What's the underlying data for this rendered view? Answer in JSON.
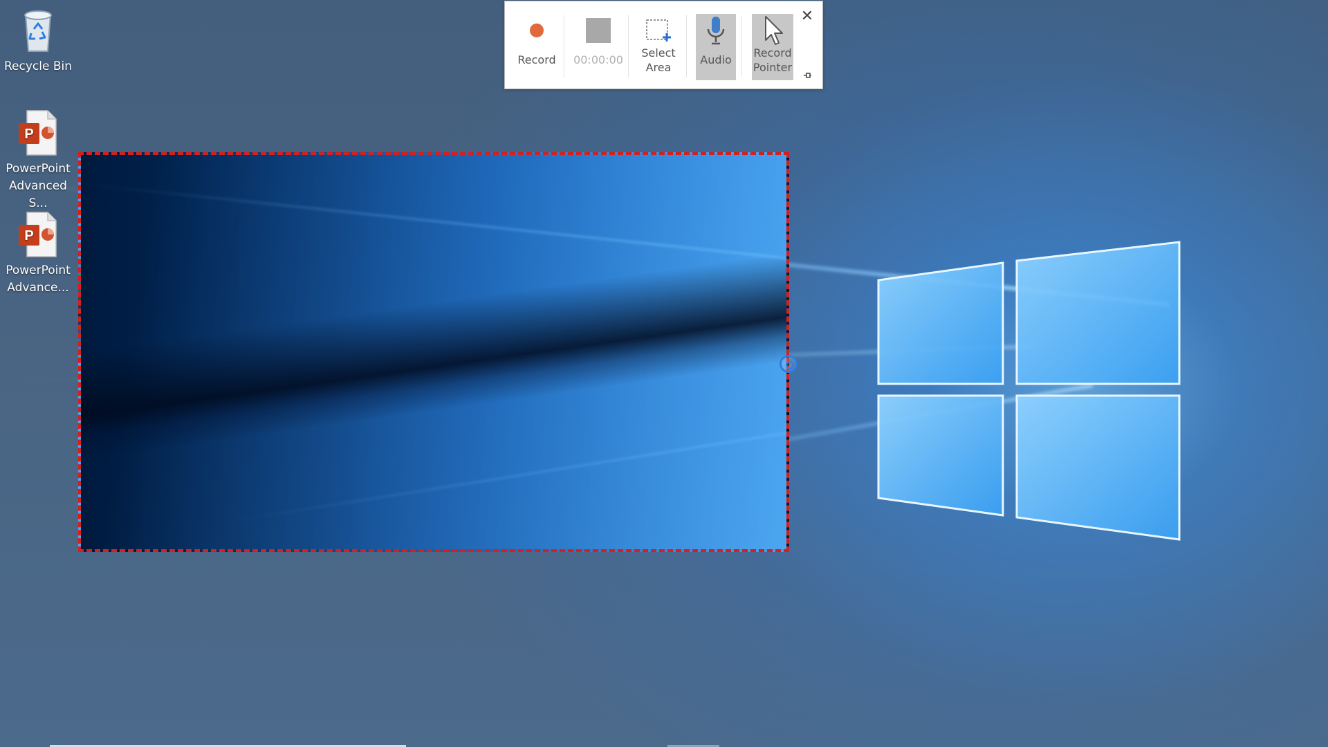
{
  "desktop": {
    "icons": [
      {
        "label": "Recycle Bin",
        "icon": "recycle-bin-icon"
      },
      {
        "label": "PowerPoint Advanced S...",
        "icon": "powerpoint-file-icon"
      },
      {
        "label": "PowerPoint Advance...",
        "icon": "powerpoint-file-icon"
      }
    ]
  },
  "toolbar": {
    "record_label": "Record",
    "timer_label": "00:00:00",
    "select_area_label": "Select Area",
    "audio_label": "Audio",
    "record_pointer_label": "Record Pointer",
    "close_icon": "close-icon",
    "pin_icon": "pin-icon",
    "record_color": "#e06a3c",
    "stop_color": "#a8a8a8"
  },
  "selection": {
    "border_color": "#d32020"
  },
  "colors": {
    "accent": "#2a7fe0"
  }
}
